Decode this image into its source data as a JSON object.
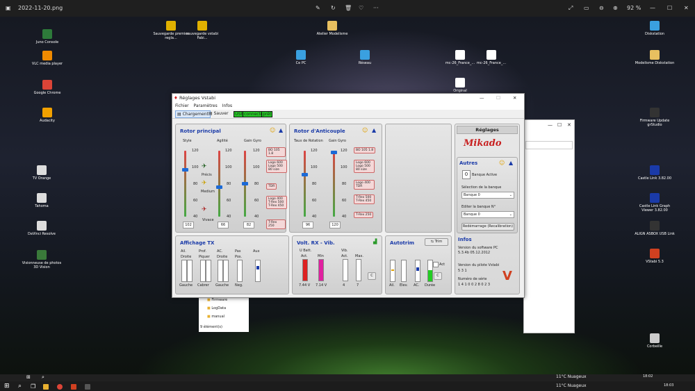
{
  "viewer": {
    "filename": "2022-11-20.png",
    "zoom": "92 %",
    "dots": "···"
  },
  "desktop_icons": [
    {
      "label": "Juno Console",
      "color": "#2d7a3a"
    },
    {
      "label": "VLC media player",
      "color": "#f08a00"
    },
    {
      "label": "Google Chrome",
      "color": "#db4437"
    },
    {
      "label": "Audacity",
      "color": "#f2a100"
    },
    {
      "label": "TV Orange",
      "color": "#dddddd"
    },
    {
      "label": "Tahoma",
      "color": "#dddddd"
    },
    {
      "label": "DaVinci Resolve",
      "color": "#dddddd"
    },
    {
      "label": "Visionneuse de photos 3D Vision",
      "color": "#3a7a3a"
    },
    {
      "label": "Sauvegarde premier regla...",
      "color": "#e0b000"
    },
    {
      "label": "sauvegarde vstabi Fabi...",
      "color": "#e0b000"
    },
    {
      "label": "Atelier Modelisme",
      "color": "#e8c060"
    },
    {
      "label": "Ce PC",
      "color": "#3aa0e0"
    },
    {
      "label": "Réseau",
      "color": "#3aa0e0"
    },
    {
      "label": "mc-26_France_...",
      "color": "#ffffff"
    },
    {
      "label": "mc-26_France_...",
      "color": "#ffffff"
    },
    {
      "label": "Original",
      "color": "#ffffff"
    },
    {
      "label": "Diskstation",
      "color": "#3aa0e0"
    },
    {
      "label": "Modelisme Diskstation",
      "color": "#e8c060"
    },
    {
      "label": "Firmware Update grStudio",
      "color": "#333333"
    },
    {
      "label": "Castle Link 3.82.00",
      "color": "#1a3aa8"
    },
    {
      "label": "Castle Link Graph Viewer 3.82.00",
      "color": "#1a3aa8"
    },
    {
      "label": "ALIGN ASBOX USB Link",
      "color": "#333333"
    },
    {
      "label": "VStabi 5.3",
      "color": "#d04020"
    },
    {
      "label": "Corbeille",
      "color": "#cccccc"
    }
  ],
  "app": {
    "title": "Réglages Vstabi",
    "menu": [
      "Fichier",
      "Paramètres",
      "Infos"
    ],
    "toolbar": {
      "chargement": "Chargement",
      "sauver": "Sauver",
      "usb": "USB",
      "connected": "connecter",
      "ready": "prêt"
    },
    "rotor_principal": {
      "title": "Rotor principal",
      "cols": [
        "Style",
        "Agilité",
        "Gain Gyro"
      ],
      "scale": [
        "120",
        "100",
        "80",
        "60",
        "40"
      ],
      "styles": [
        "Précis",
        "Medium",
        "Vivace"
      ],
      "gyro_tags": [
        "BO 105 1.8",
        "Logo 600 Logo 500 80 size",
        "TDR",
        "Logo 400 T-Rex 500 T-Rex 450",
        "T-Rex 250"
      ],
      "values": [
        "102",
        "66",
        "82"
      ],
      "levels": [
        0.72,
        0.44,
        0.5
      ]
    },
    "rotor_anticouple": {
      "title": "Rotor d'Anticouple",
      "cols": [
        "Taux de Rotation",
        "Gain Gyro"
      ],
      "scale": [
        "120",
        "100",
        "80",
        "60",
        "40"
      ],
      "tags": [
        "BO 105 1.8",
        "Logo 600 Logo 500 80 size",
        "Logo 400 TDR",
        "T-Rex 500 T-Rex 450",
        "T-Rex 250"
      ],
      "values": [
        "96",
        "120"
      ],
      "levels": [
        0.65,
        1.0
      ]
    },
    "reglages": {
      "title": "Réglages",
      "logo": "Mikado"
    },
    "autres": {
      "title": "Autres",
      "banque_active_value": "0",
      "banque_active_label": "Banque Active",
      "selection_label": "Sélection de la banque",
      "selection_value": "Banque 0",
      "editer_label": "Editer la banque N°",
      "editer_value": "Banque 0",
      "restart_button": "Redémarrage (Recalibration)"
    },
    "infos": {
      "title": "Infos",
      "version_pc_label": "Version du software PC",
      "version_pc_value": "5.3.4b  05.12.2012",
      "version_pilote_label": "Version du pilote Vstabi",
      "version_pilote_value": "5    3    1",
      "serie_label": "Numéro de série",
      "serie_value": "1 4 1 0 0 2 8 0 2 3"
    },
    "affichage_tx": {
      "title": "Affichage TX",
      "top": [
        "Ail.",
        "Prof.",
        "AC.",
        "Pas",
        "Aux"
      ],
      "sub": [
        "Droite",
        "Piquer",
        "Droite",
        "Pos."
      ],
      "bottom": [
        "Gauche",
        "Cabrer",
        "Gauche",
        "Neg."
      ]
    },
    "volt": {
      "title": "Volt. RX - Vib.",
      "ubatt": "U Batt.",
      "vib": "Vib.",
      "cols": [
        "Act.",
        "Min",
        "Act.",
        "Max."
      ],
      "values": [
        "7.44 V",
        "7.14 V",
        "4",
        "7"
      ],
      "c_button": "C"
    },
    "autotrim": {
      "title": "Autotrim",
      "trim_button": "Trim",
      "act_label": "Act",
      "c_button": "C",
      "cols": [
        "Ail.",
        "Elev.",
        "AC.",
        "Durée"
      ]
    }
  },
  "explorer": {
    "items": [
      "Firmware",
      "LogData",
      "manual"
    ],
    "count": "9 élément(s)"
  },
  "taskbar": {
    "weather1": "11°C  Nuageux",
    "time1": "18:02",
    "weather2": "11°C  Nuageux",
    "time2": "18:03"
  },
  "colors": {
    "accent_blue": "#1a3aa8",
    "usb_green": "#22cc22",
    "red": "#dd2222",
    "magenta": "#e020a0"
  }
}
